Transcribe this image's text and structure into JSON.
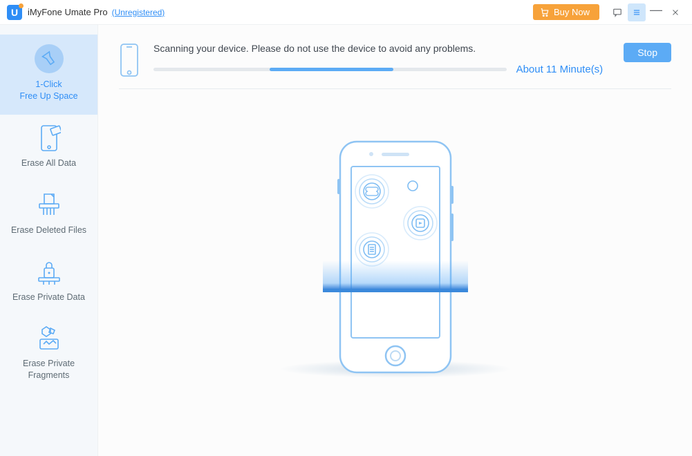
{
  "titlebar": {
    "app_name": "iMyFone Umate Pro",
    "registration": "(Unregistered)",
    "buy_now_label": "Buy Now"
  },
  "sidebar": {
    "items": [
      {
        "label": "1-Click\nFree Up Space",
        "icon": "flashlight-icon",
        "active": true
      },
      {
        "label": "Erase All Data",
        "icon": "device-erase-icon",
        "active": false
      },
      {
        "label": "Erase Deleted Files",
        "icon": "shredder-icon",
        "active": false
      },
      {
        "label": "Erase Private Data",
        "icon": "lock-erase-icon",
        "active": false
      },
      {
        "label": "Erase Private\nFragments",
        "icon": "fragments-icon",
        "active": false
      }
    ]
  },
  "scan": {
    "message": "Scanning your device. Please do not use the device to avoid any problems.",
    "eta_text": "About 11 Minute(s)",
    "stop_label": "Stop",
    "progress_indeterminate": true
  },
  "colors": {
    "accent": "#5cabf5",
    "accent_deep": "#2f8ef6",
    "buy_orange": "#f7a23a",
    "sidebar_bg": "#f5f8fb",
    "sidebar_active_bg": "#d6e8fb"
  }
}
